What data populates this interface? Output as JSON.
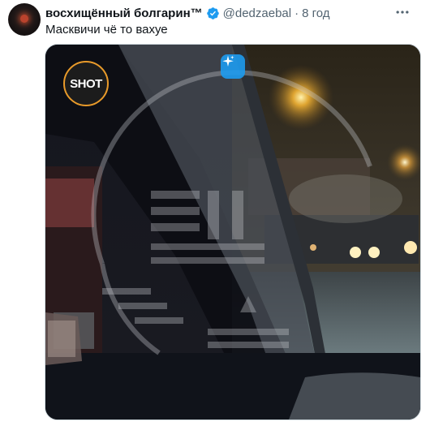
{
  "tweet": {
    "display_name": "восхищённый болгарин™",
    "handle": "@dedzaebal",
    "separator": "·",
    "time": "8 год",
    "text": "Масквичи чё то вахуе"
  },
  "media": {
    "watermark_logo": "SHOT"
  },
  "icons": {
    "verified": "verified-badge-icon",
    "more": "more-options-icon",
    "grok": "sparkle-icon"
  },
  "colors": {
    "accent": "#1d9bf0",
    "muted_text": "#536471",
    "primary_text": "#0f1419",
    "logo_ring": "#e89a2a"
  }
}
